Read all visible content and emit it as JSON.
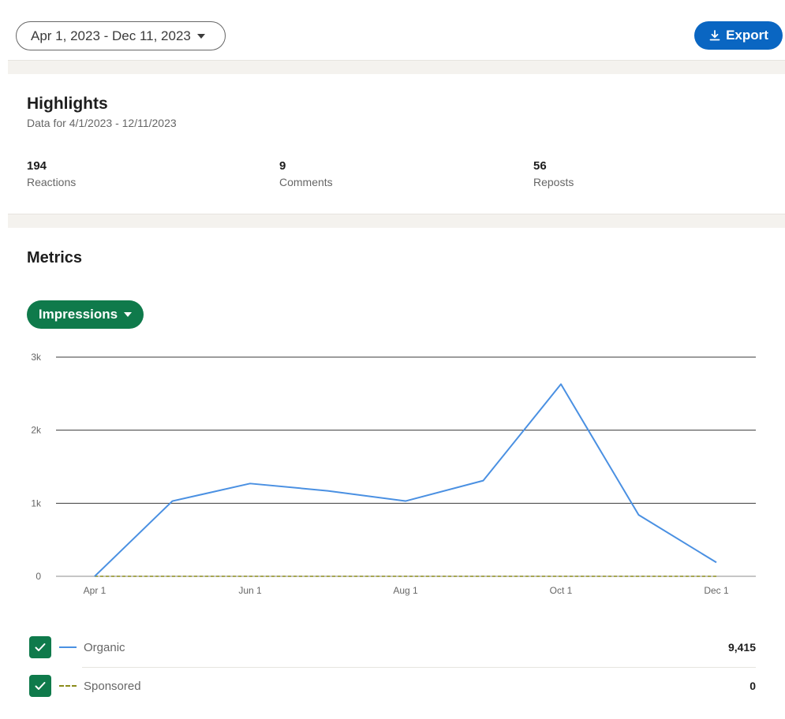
{
  "toolbar": {
    "date_range": "Apr 1, 2023 - Dec 11, 2023",
    "export_label": "Export"
  },
  "highlights": {
    "title": "Highlights",
    "subtitle": "Data for 4/1/2023 - 12/11/2023",
    "stats": [
      {
        "value": "194",
        "label": "Reactions"
      },
      {
        "value": "9",
        "label": "Comments"
      },
      {
        "value": "56",
        "label": "Reposts"
      }
    ]
  },
  "metrics": {
    "title": "Metrics",
    "selector": "Impressions"
  },
  "colors": {
    "primary_blue": "#0a66c2",
    "green": "#0f7a4b",
    "organic_line": "#4a90e2",
    "sponsored_line": "#8a8b1a"
  },
  "chart_data": {
    "type": "line",
    "x": [
      "Apr 1",
      "May 1",
      "Jun 1",
      "Jul 1",
      "Aug 1",
      "Sep 1",
      "Oct 1",
      "Nov 1",
      "Dec 1"
    ],
    "x_ticks": [
      "Apr 1",
      "Jun 1",
      "Aug 1",
      "Oct 1",
      "Dec 1"
    ],
    "y_ticks": [
      "0",
      "1k",
      "2k",
      "3k"
    ],
    "ylim": [
      0,
      3000
    ],
    "grid": true,
    "series": [
      {
        "name": "Organic",
        "values": [
          0,
          1030,
          1270,
          1170,
          1030,
          1310,
          2630,
          840,
          190
        ]
      },
      {
        "name": "Sponsored",
        "values": [
          0,
          0,
          0,
          0,
          0,
          0,
          0,
          0,
          0
        ]
      }
    ]
  },
  "legend": [
    {
      "name": "Organic",
      "total": "9,415",
      "checked": true
    },
    {
      "name": "Sponsored",
      "total": "0",
      "checked": true
    }
  ]
}
